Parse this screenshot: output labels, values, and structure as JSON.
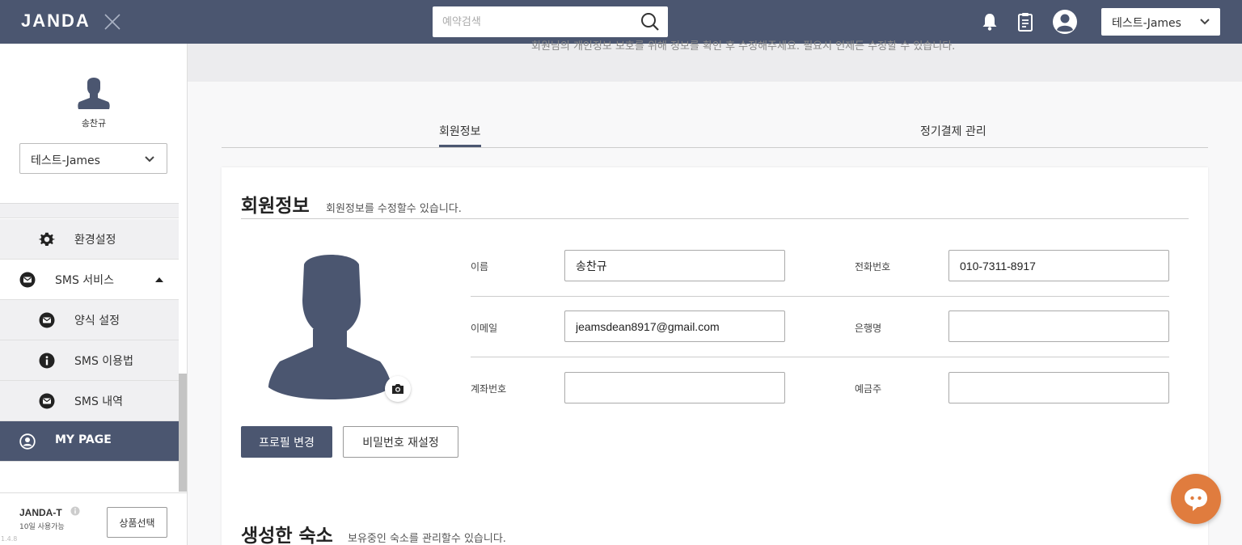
{
  "header": {
    "logo": "JANDA",
    "search_placeholder": "예약검색",
    "account_select": "테스트-James"
  },
  "sidebar": {
    "user_name": "송찬규",
    "account_select": "테스트-James",
    "menu": [
      {
        "label": "환경설정",
        "icon": "gear-icon"
      },
      {
        "label": "SMS 서비스",
        "icon": "mail-icon",
        "expanded": true
      },
      {
        "label": "양식 설정",
        "icon": "mail-icon"
      },
      {
        "label": "SMS 이용법",
        "icon": "info-icon"
      },
      {
        "label": "SMS 내역",
        "icon": "mail-icon"
      },
      {
        "label": "MY PAGE",
        "icon": "user-circle-icon",
        "active": true
      }
    ],
    "footer": {
      "plan_name": "JANDA-T",
      "plan_days": "10일 사용가능",
      "plan_button": "상품선택",
      "version": "1.4.8"
    }
  },
  "main": {
    "banner_text": "회원님의 개인정보 보호를 위해 정보를 확인 후 수정해주세요. 필요시 언제든 수정할 수 있습니다.",
    "tabs": [
      {
        "label": "회원정보",
        "active": true
      },
      {
        "label": "정기결제 관리",
        "active": false
      }
    ],
    "member_info": {
      "title": "회원정보",
      "subtitle": "회원정보를 수정할수 있습니다.",
      "fields": {
        "name": {
          "label": "이름",
          "value": "송찬규"
        },
        "phone": {
          "label": "전화번호",
          "value": "010-7311-8917"
        },
        "email": {
          "label": "이메일",
          "value": "jeamsdean8917@gmail.com"
        },
        "bank": {
          "label": "은행명",
          "value": ""
        },
        "account": {
          "label": "계좌번호",
          "value": ""
        },
        "holder": {
          "label": "예금주",
          "value": ""
        }
      },
      "profile_button": "프로필 변경",
      "password_button": "비밀번호 재설정"
    },
    "properties": {
      "title": "생성한 숙소",
      "subtitle": "보유중인 숙소를 관리할수 있습니다."
    }
  },
  "colors": {
    "primary": "#4b5670",
    "chat": "#e07c3e"
  }
}
